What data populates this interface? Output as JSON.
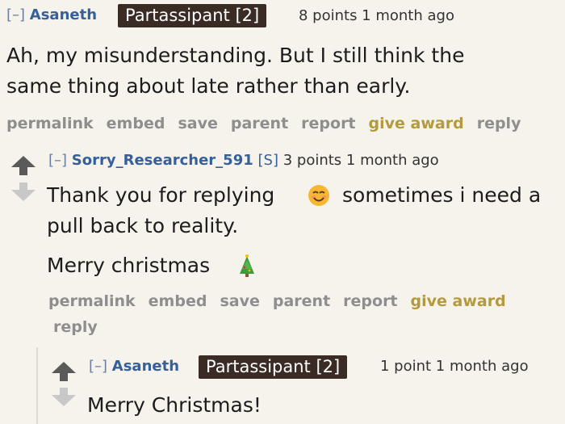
{
  "comments": [
    {
      "collapse": "[–]",
      "author": "Asaneth",
      "flair": "Partassipant [2]",
      "meta": "8 points 1 month ago",
      "lines": [
        "Ah, my misunderstanding. But I still think the",
        "same thing about late rather than early."
      ],
      "actions": [
        "permalink",
        "embed",
        "save",
        "parent",
        "report",
        "give award",
        "reply"
      ]
    },
    {
      "collapse": "[–]",
      "author": "Sorry_Researcher_591",
      "submitter_tag": "[S]",
      "meta": "3 points 1 month ago",
      "lines": [
        "Thank you for replying",
        "sometimes i need a",
        "pull back to reality.",
        "Merry christmas"
      ],
      "emoji_icons": [
        "smiling-face-icon",
        "christmas-tree-icon"
      ],
      "actions": [
        "permalink",
        "embed",
        "save",
        "parent",
        "report",
        "give award",
        "reply"
      ]
    },
    {
      "collapse": "[–]",
      "author": "Asaneth",
      "flair": "Partassipant [2]",
      "meta": "1 point 1 month ago",
      "lines": [
        "Merry Christmas!"
      ]
    }
  ],
  "colors": {
    "background": "#f6f3ec",
    "author": "#35609a",
    "flair_bg": "#3a2b24",
    "award": "#b39a3e",
    "action": "#8e8e8e"
  }
}
